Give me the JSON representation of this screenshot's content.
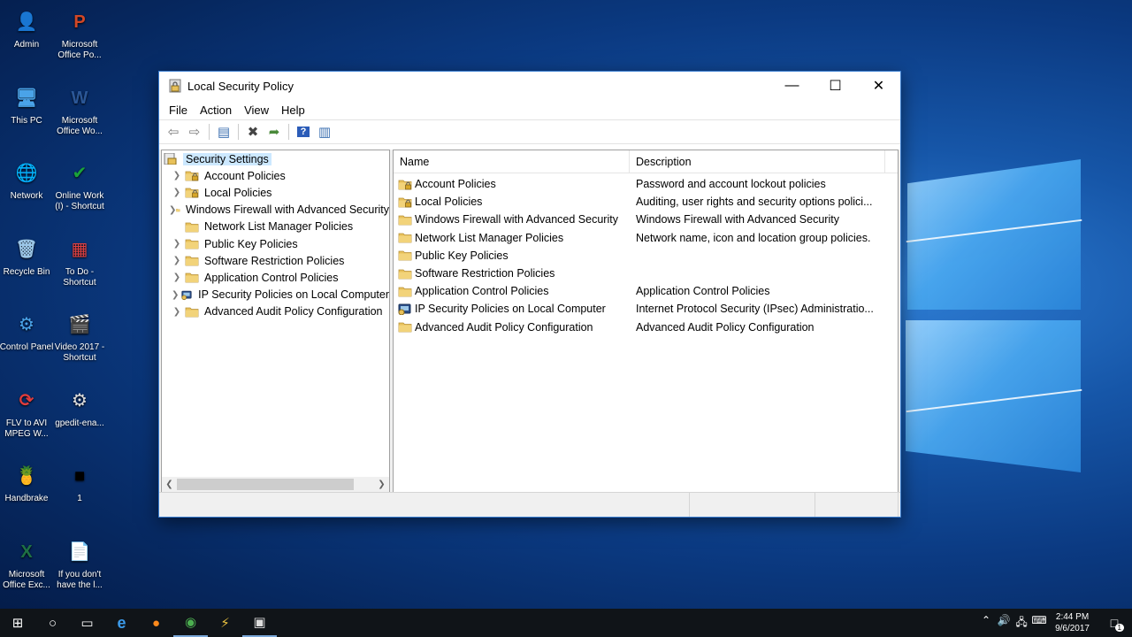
{
  "desktop_icons": [
    {
      "label": "Admin",
      "glyph": "👤",
      "icon": "user-folder-icon",
      "color": "#e8b84a"
    },
    {
      "label": "Microsoft Office Po...",
      "glyph": "P",
      "icon": "powerpoint-icon",
      "color": "#d24726"
    },
    {
      "label": "This PC",
      "glyph": "🖥",
      "icon": "computer-icon",
      "color": "#4aa3e8"
    },
    {
      "label": "Microsoft Office Wo...",
      "glyph": "W",
      "icon": "word-icon",
      "color": "#2b5797"
    },
    {
      "label": "Network",
      "glyph": "🌐",
      "icon": "network-icon",
      "color": "#3c8fd8"
    },
    {
      "label": "Online Work (I) - Shortcut",
      "glyph": "✔",
      "icon": "shield-check-icon",
      "color": "#1aa33a"
    },
    {
      "label": "Recycle Bin",
      "glyph": "🗑",
      "icon": "recycle-bin-icon",
      "color": "#9cc7e8"
    },
    {
      "label": "To Do - Shortcut",
      "glyph": "▦",
      "icon": "todo-app-icon",
      "color": "#e04040"
    },
    {
      "label": "Control Panel",
      "glyph": "⚙",
      "icon": "control-panel-icon",
      "color": "#4aa3e8"
    },
    {
      "label": "Video 2017 - Shortcut",
      "glyph": "🎬",
      "icon": "video-icon",
      "color": "#4a90d8"
    },
    {
      "label": "FLV to AVI MPEG W...",
      "glyph": "⟳",
      "icon": "converter-icon",
      "color": "#e03c3c"
    },
    {
      "label": "gpedit-ena...",
      "glyph": "⚙",
      "icon": "settings-file-icon",
      "color": "#dcdcdc"
    },
    {
      "label": "Handbrake",
      "glyph": "🍍",
      "icon": "handbrake-icon",
      "color": "#e8a030"
    },
    {
      "label": "1",
      "glyph": "■",
      "icon": "terminal-icon",
      "color": "#000000"
    },
    {
      "label": "Microsoft Office Exc...",
      "glyph": "X",
      "icon": "excel-icon",
      "color": "#1e7145"
    },
    {
      "label": "If you don't have the l...",
      "glyph": "📄",
      "icon": "text-document-icon",
      "color": "#ffffff"
    }
  ],
  "window": {
    "title": "Local Security Policy",
    "menu": [
      "File",
      "Action",
      "View",
      "Help"
    ],
    "controls": {
      "minimize": "—",
      "maximize": "☐",
      "close": "✕"
    }
  },
  "toolbar": [
    {
      "icon": "back-arrow-icon",
      "glyph": "⇦"
    },
    {
      "icon": "forward-arrow-icon",
      "glyph": "⇨"
    },
    {
      "icon": "show-hide-tree-icon",
      "glyph": "▤"
    },
    {
      "icon": "delete-icon",
      "glyph": "✖"
    },
    {
      "icon": "export-list-icon",
      "glyph": "➦"
    },
    {
      "icon": "help-icon",
      "glyph": "?"
    },
    {
      "icon": "action-pane-icon",
      "glyph": "▥"
    }
  ],
  "tree": {
    "root": "Security Settings",
    "items": [
      {
        "label": "Account Policies",
        "icon": "lock-folder"
      },
      {
        "label": "Local Policies",
        "icon": "lock-folder"
      },
      {
        "label": "Windows Firewall with Advanced Security",
        "icon": "folder"
      },
      {
        "label": "Network List Manager Policies",
        "icon": "folder"
      },
      {
        "label": "Public Key Policies",
        "icon": "folder"
      },
      {
        "label": "Software Restriction Policies",
        "icon": "folder"
      },
      {
        "label": "Application Control Policies",
        "icon": "folder"
      },
      {
        "label": "IP Security Policies on Local Computer",
        "icon": "ipsec"
      },
      {
        "label": "Advanced Audit Policy Configuration",
        "icon": "folder"
      }
    ]
  },
  "list": {
    "columns": [
      "Name",
      "Description"
    ],
    "rows": [
      {
        "name": "Account Policies",
        "desc": "Password and account lockout policies",
        "icon": "lock-folder"
      },
      {
        "name": "Local Policies",
        "desc": "Auditing, user rights and security options polici...",
        "icon": "lock-folder"
      },
      {
        "name": "Windows Firewall with Advanced Security",
        "desc": "Windows Firewall with Advanced Security",
        "icon": "folder"
      },
      {
        "name": "Network List Manager Policies",
        "desc": "Network name, icon and location group policies.",
        "icon": "folder"
      },
      {
        "name": "Public Key Policies",
        "desc": "",
        "icon": "folder"
      },
      {
        "name": "Software Restriction Policies",
        "desc": "",
        "icon": "folder"
      },
      {
        "name": "Application Control Policies",
        "desc": "Application Control Policies",
        "icon": "folder"
      },
      {
        "name": "IP Security Policies on Local Computer",
        "desc": "Internet Protocol Security (IPsec) Administratio...",
        "icon": "ipsec"
      },
      {
        "name": "Advanced Audit Policy Configuration",
        "desc": "Advanced Audit Policy Configuration",
        "icon": "folder"
      }
    ]
  },
  "taskbar": {
    "items": [
      {
        "icon": "windows-start-icon",
        "glyph": "⊞",
        "color": "#ffffff"
      },
      {
        "icon": "cortana-search-icon",
        "glyph": "○",
        "color": "#ffffff"
      },
      {
        "icon": "task-view-icon",
        "glyph": "▭",
        "color": "#ffffff"
      },
      {
        "icon": "edge-browser-icon",
        "glyph": "e",
        "color": "#3c9bea"
      },
      {
        "icon": "firefox-icon",
        "glyph": "●",
        "color": "#ff8a1c"
      },
      {
        "icon": "chrome-icon",
        "glyph": "◉",
        "color": "#4caf50"
      },
      {
        "icon": "tools-app-icon",
        "glyph": "⚡",
        "color": "#e8c040"
      },
      {
        "icon": "local-security-policy-icon",
        "glyph": "▣",
        "color": "#dddddd"
      }
    ],
    "tray_icons": [
      {
        "icon": "tray-chevron-up-icon",
        "glyph": "⌃"
      },
      {
        "icon": "volume-icon",
        "glyph": "🔊"
      },
      {
        "icon": "network-tray-icon",
        "glyph": "🖧"
      },
      {
        "icon": "keyboard-icon",
        "glyph": "⌨"
      }
    ],
    "time": "2:44 PM",
    "date": "9/6/2017",
    "notification_badge": "1"
  },
  "colors": {
    "selection": "#cce8ff",
    "folder": "#e8c15a",
    "accent": "#3b7fd1"
  }
}
